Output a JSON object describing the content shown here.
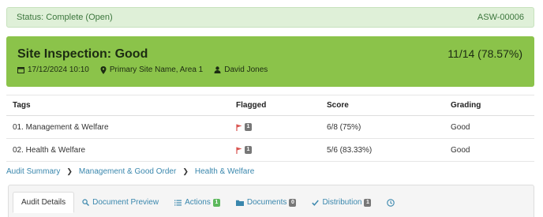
{
  "status": {
    "text": "Status: Complete (Open)",
    "id": "ASW-00006"
  },
  "hero": {
    "title": "Site Inspection: Good",
    "score": "11/14 (78.57%)",
    "date": "17/12/2024 10:10",
    "location": "Primary Site Name, Area 1",
    "user": "David Jones"
  },
  "table": {
    "headers": [
      "Tags",
      "Flagged",
      "Score",
      "Grading"
    ],
    "rows": [
      {
        "tag": "01. Management & Welfare",
        "flag_count": "1",
        "score": "6/8 (75%)",
        "grading": "Good"
      },
      {
        "tag": "02. Health & Welfare",
        "flag_count": "1",
        "score": "5/6 (83.33%)",
        "grading": "Good"
      }
    ]
  },
  "breadcrumb": [
    "Audit Summary",
    "Management & Good Order",
    "Health & Welfare"
  ],
  "tabs": [
    {
      "label": "Audit Details",
      "icon": "none",
      "active": true
    },
    {
      "label": "Document Preview",
      "icon": "search-icon"
    },
    {
      "label": "Actions",
      "icon": "list-icon",
      "badge": "1"
    },
    {
      "label": "Documents",
      "icon": "folder-icon",
      "badge": "0"
    },
    {
      "label": "Distribution",
      "icon": "check-icon",
      "badge": "1"
    },
    {
      "label": "",
      "icon": "clock-icon"
    }
  ],
  "colors": {
    "hero_bg": "#8bc34a",
    "status_bg": "#dff0d8",
    "link": "#3a87ad",
    "grade_good": "#8bc34a",
    "flag": "#d9534f"
  }
}
